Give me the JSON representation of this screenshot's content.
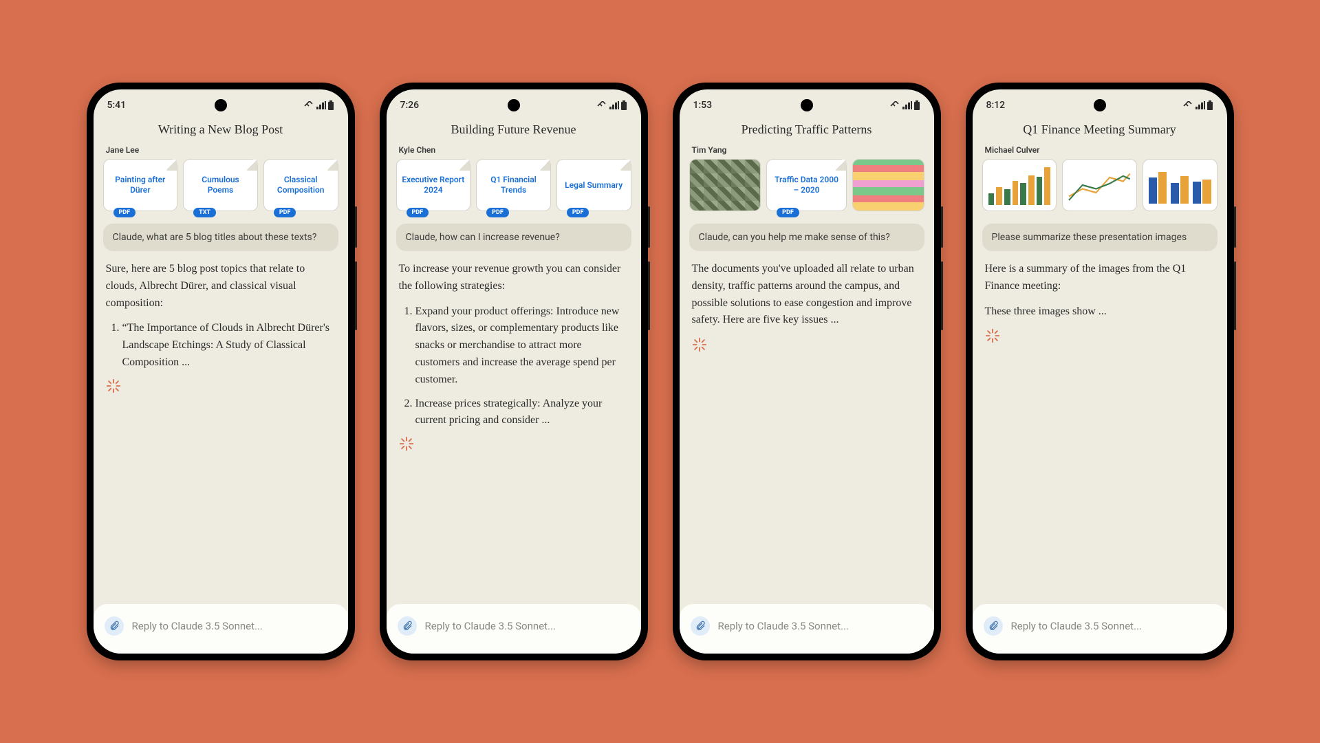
{
  "phones": [
    {
      "time": "5:41",
      "title": "Writing a New Blog Post",
      "user": "Jane Lee",
      "attachments": [
        {
          "kind": "file",
          "name": "Painting after Dürer",
          "badge": "PDF"
        },
        {
          "kind": "file",
          "name": "Cumulous Poems",
          "badge": "TXT"
        },
        {
          "kind": "file",
          "name": "Classical Composition",
          "badge": "PDF"
        }
      ],
      "prompt": "Claude, what are 5 blog titles about these texts?",
      "response_intro": "Sure, here are 5 blog post topics that relate to clouds, Albrecht Dürer, and classical visual composition:",
      "response_items": [
        "“The Importance of Clouds in Albrecht Dürer's Landscape Etchings: A Study of Classical Composition ..."
      ],
      "input_placeholder": "Reply to Claude 3.5 Sonnet..."
    },
    {
      "time": "7:26",
      "title": "Building Future Revenue",
      "user": "Kyle Chen",
      "attachments": [
        {
          "kind": "file",
          "name": "Executive Report 2024",
          "badge": "PDF"
        },
        {
          "kind": "file",
          "name": "Q1 Financial Trends",
          "badge": "PDF"
        },
        {
          "kind": "file",
          "name": "Legal Summary",
          "badge": "PDF"
        }
      ],
      "prompt": "Claude, how can I increase revenue?",
      "response_intro": "To increase your revenue growth you can consider the following strategies:",
      "response_items": [
        "Expand your product offerings: Introduce new flavors, sizes, or complementary products like snacks or merchandise to attract more customers and increase the average spend per customer.",
        "Increase prices strategically: Analyze your current pricing and consider ..."
      ],
      "input_placeholder": "Reply to Claude 3.5 Sonnet..."
    },
    {
      "time": "1:53",
      "title": "Predicting Traffic Patterns",
      "user": "Tim Yang",
      "attachments": [
        {
          "kind": "image",
          "style": "aerial"
        },
        {
          "kind": "file",
          "name": "Traffic Data 2000 – 2020",
          "badge": "PDF"
        },
        {
          "kind": "image",
          "style": "sticky"
        }
      ],
      "prompt": "Claude, can you help me make sense of this?",
      "response_intro": "The documents you've uploaded all relate to urban density, traffic patterns around the campus, and possible solutions to ease congestion and improve safety. Here are five key issues ...",
      "response_items": [],
      "input_placeholder": "Reply to Claude 3.5 Sonnet..."
    },
    {
      "time": "8:12",
      "title": "Q1 Finance Meeting Summary",
      "user": "Michael Culver",
      "attachments": [
        {
          "kind": "image",
          "style": "chart-bars"
        },
        {
          "kind": "image",
          "style": "chart-line"
        },
        {
          "kind": "image",
          "style": "chart-grouped"
        }
      ],
      "prompt": "Please summarize these presentation images",
      "response_intro": "Here is a summary of the images from the Q1 Finance meeting:",
      "response_para2": "These three images show ...",
      "response_items": [],
      "input_placeholder": "Reply to Claude 3.5 Sonnet..."
    }
  ]
}
